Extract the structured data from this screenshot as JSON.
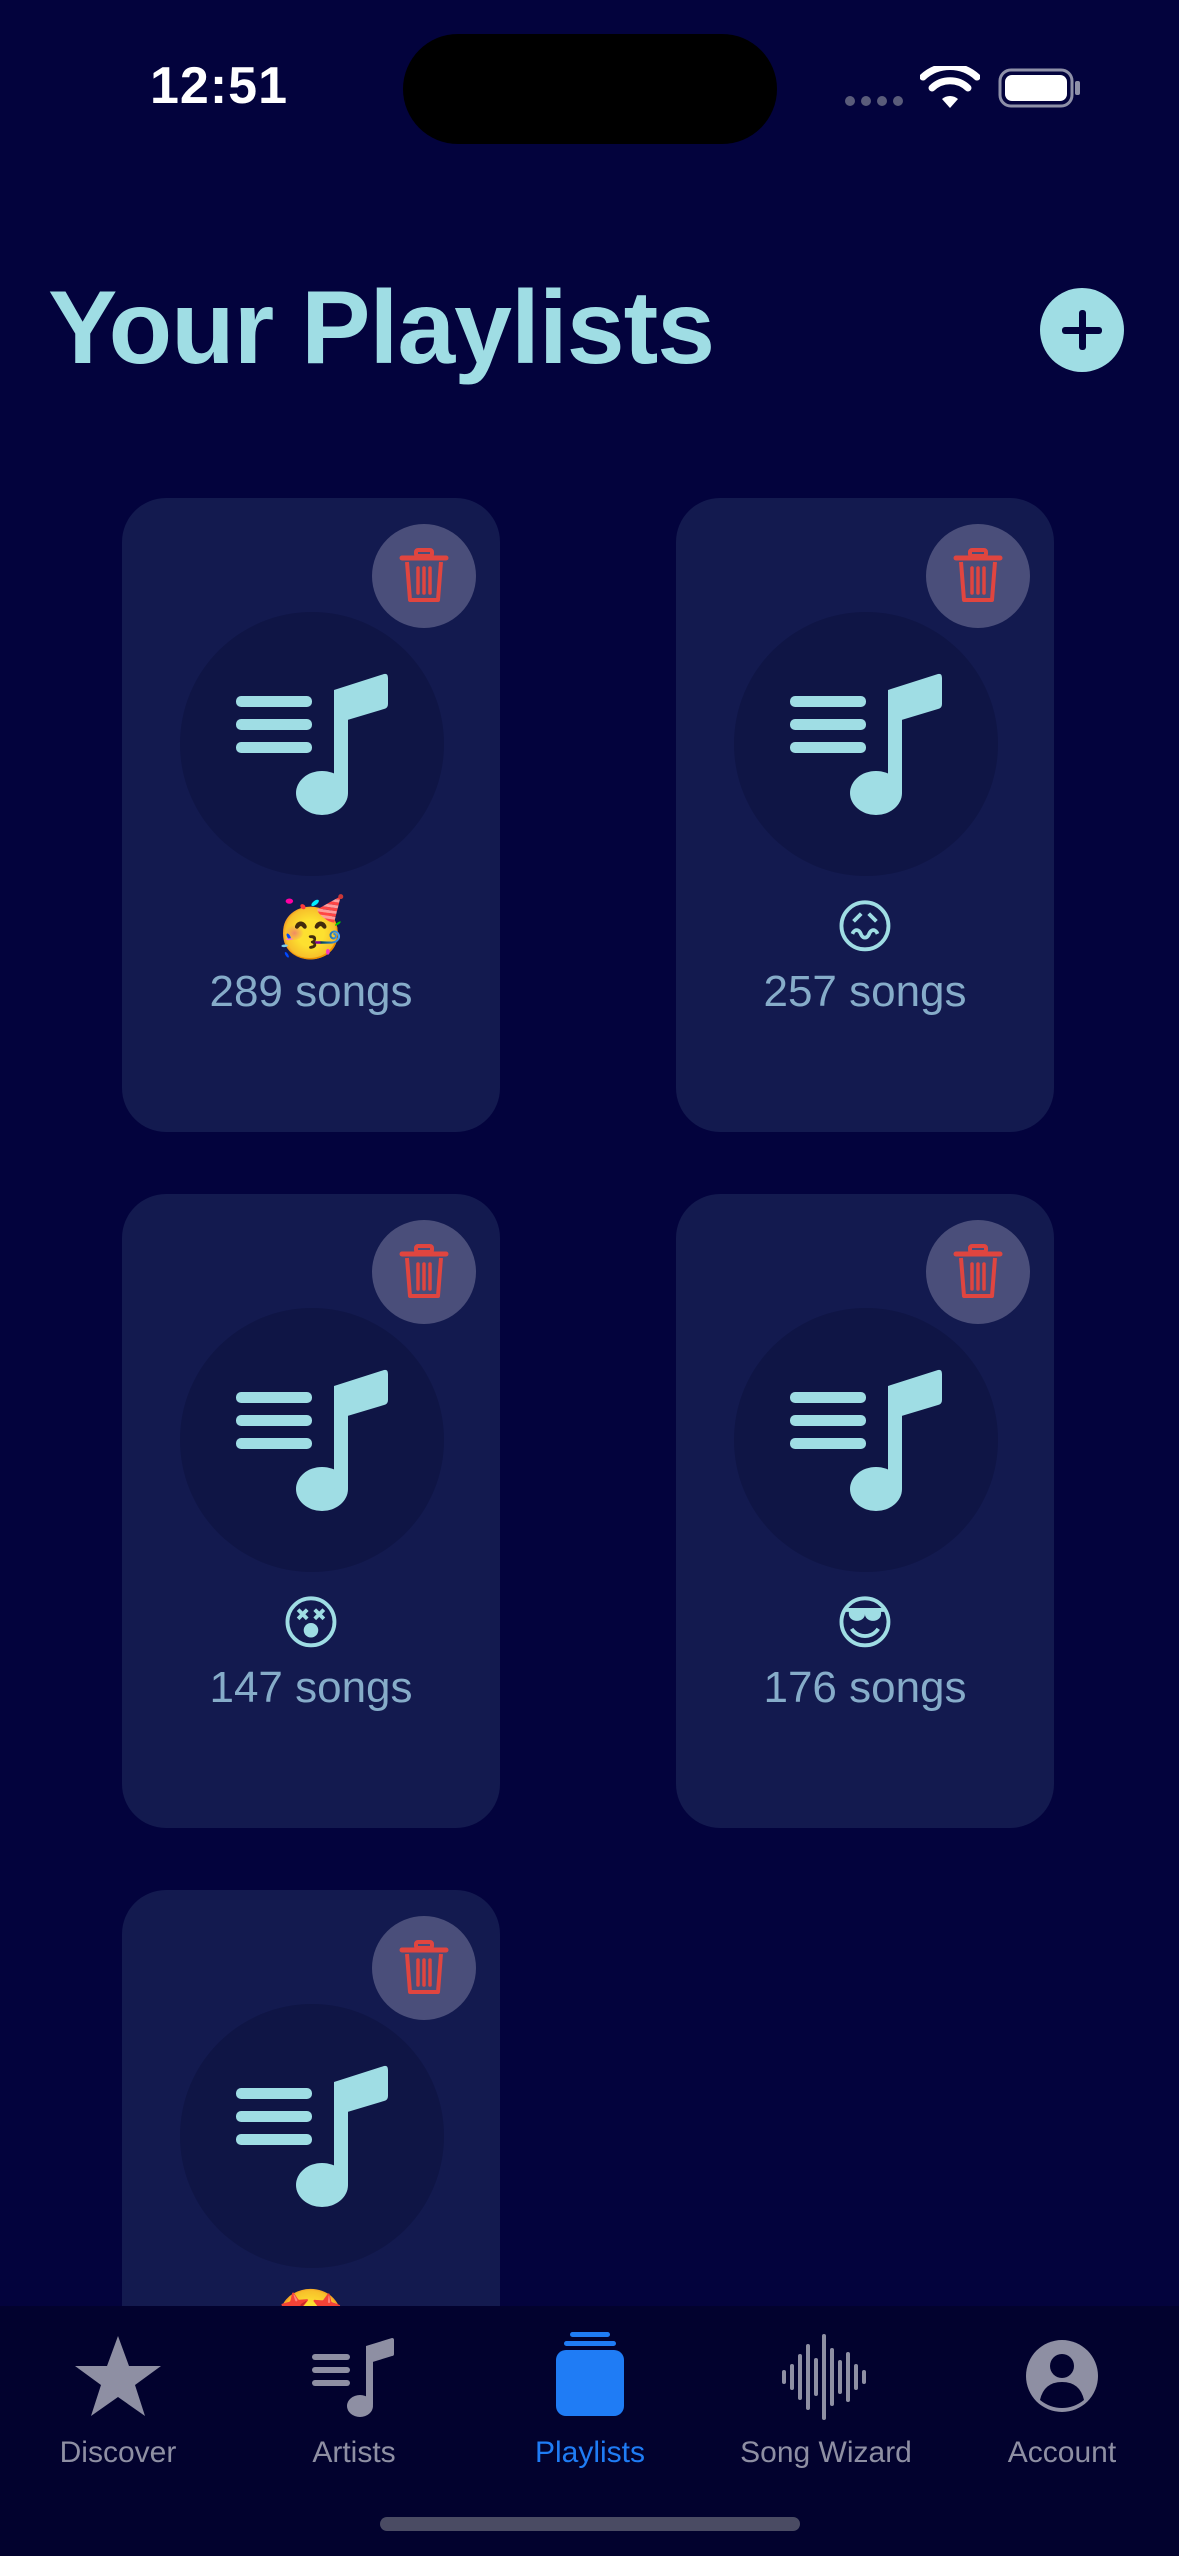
{
  "status_bar": {
    "time": "12:51"
  },
  "header": {
    "title": "Your Playlists",
    "add_icon": "plus-circle-icon"
  },
  "playlists": [
    {
      "emoji": "🥳",
      "song_count": "289 songs"
    },
    {
      "emoji": "😖",
      "song_count": "257 songs"
    },
    {
      "emoji": "😵",
      "song_count": "147 songs"
    },
    {
      "emoji": "😎",
      "song_count": "176 songs"
    },
    {
      "emoji": "🤩",
      "song_count": ""
    }
  ],
  "tab_bar": {
    "active": "Playlists",
    "tabs": [
      {
        "label": "Discover",
        "icon": "star-icon"
      },
      {
        "label": "Artists",
        "icon": "music-list-icon"
      },
      {
        "label": "Playlists",
        "icon": "stack-icon"
      },
      {
        "label": "Song Wizard",
        "icon": "waveform-icon"
      },
      {
        "label": "Account",
        "icon": "person-circle-icon"
      }
    ]
  },
  "colors": {
    "background": "#03033d",
    "card": "#131a4f",
    "accent": "#9fdde4",
    "trash_red": "#e0453f",
    "active_tab": "#1f7cf5",
    "inactive_tab": "#8e8fa3"
  }
}
